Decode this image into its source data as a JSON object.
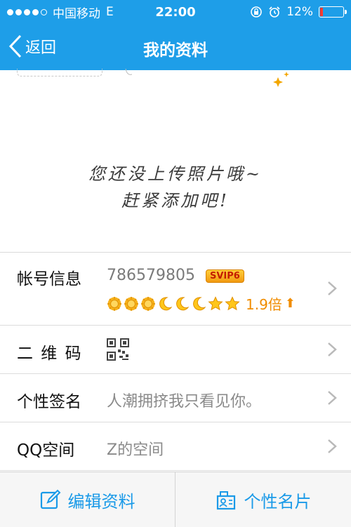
{
  "status": {
    "carrier": "中国移动",
    "network": "E",
    "time": "22:00",
    "battery": "12%",
    "battery_level": 0.12,
    "battery_color": "#ff3b30"
  },
  "nav": {
    "back_label": "返回",
    "title": "我的资料"
  },
  "photo": {
    "note_line1": "您还没上传照片哦~",
    "note_line2": "赶紧添加吧!"
  },
  "rows": {
    "account": {
      "label": "帐号信息",
      "value": "786579805",
      "badge": "SVIP6",
      "multiplier": "1.9倍",
      "level_icons": [
        "sun-icon",
        "sun-icon",
        "sun-icon",
        "moon-icon",
        "moon-icon",
        "moon-icon",
        "star-icon",
        "star-icon"
      ]
    },
    "qrcode": {
      "label": "二 维 码"
    },
    "signature": {
      "label": "个性签名",
      "value": "人潮拥挤我只看见你。"
    },
    "qzone": {
      "label": "QQ空间",
      "value": "Z的空间"
    }
  },
  "bottom": {
    "edit_label": "编辑资料",
    "card_label": "个性名片"
  },
  "colors": {
    "brand": "#1e9ee8",
    "accent_orange": "#f08c00"
  }
}
